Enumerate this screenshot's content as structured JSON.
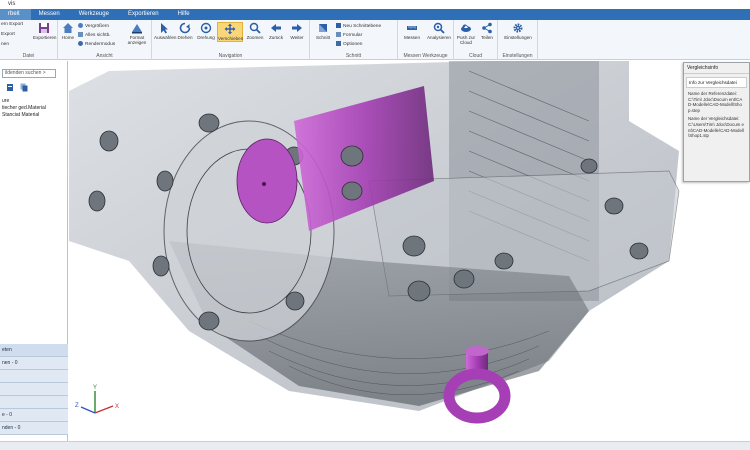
{
  "window": {
    "title": "vis"
  },
  "menu": [
    {
      "label": "rbeit",
      "active": true
    },
    {
      "label": "Messen",
      "active": false
    },
    {
      "label": "Werkzeuge",
      "active": false
    },
    {
      "label": "Exportieren",
      "active": false
    },
    {
      "label": "Hilfe",
      "active": false
    }
  ],
  "ribbon": {
    "groups": {
      "datei": "Datei",
      "ansicht": "Ansicht",
      "navigation": "Navigation",
      "schnitt": "Schnitt",
      "messen": "Messen  Werkzeuge",
      "cloud": "Cloud",
      "einstellungen": "Einstellungen"
    },
    "datei_items": [
      "ern Export",
      "Export",
      "nen"
    ],
    "export_button": "Exportieren",
    "ansicht_small": [
      "Vergrößern",
      "Alles sichtb.",
      "Rendermodus"
    ],
    "home_button": "Home",
    "format_button": "Format anzeigen",
    "nav_buttons": [
      "Auswählen",
      "Drehen",
      "Drehung",
      "Verschieben",
      "Zoomen",
      "Zurück",
      "Weiter"
    ],
    "schnitt_button": "Schnitt",
    "schnitt_small": [
      "Neu Schnittebene",
      "Formular",
      "Optionen"
    ],
    "messen_button": "Messen",
    "analysieren_button": "Analysieren",
    "cloud_buttons": [
      "Push zur Cloud",
      "Teilen"
    ],
    "settings_button": "Einstellungen"
  },
  "left_panel": {
    "search_placeholder": "ildenden suchen >",
    "tree": [
      "ure",
      "tiecher ged.Material",
      "Stanciat Material"
    ],
    "props": [
      "eten",
      "nen - 0",
      "",
      "",
      "",
      "e - 0",
      "nden - 0"
    ]
  },
  "comparison_panel": {
    "title": "Vergleichsinfo",
    "header": "Info zur Vergleichsdatei",
    "text1": "Name der Referenzdatei:C:\\Tim\\ Jdoc\\Docum ent\\CAD-Modelle\\CAD-Modell\\Shop.step",
    "text2": "Name der Vergleichsdatei:C:\\Users\\Tim\\ Jdoc\\Docum ent\\CAD-Modelle\\CAD-Modell\\Shop1.stp"
  },
  "colors": {
    "menubar": "#2f6fb5",
    "accent_active": "#f9d779",
    "highlight_part": "#b040c0"
  },
  "axes": {
    "x": "X",
    "y": "Y",
    "z": "Z"
  }
}
